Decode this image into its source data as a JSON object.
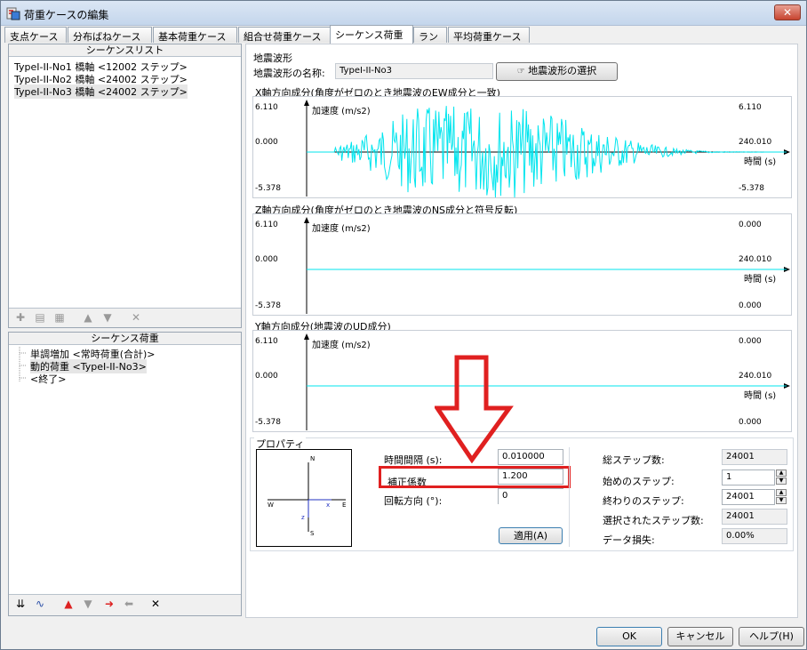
{
  "window": {
    "title": "荷重ケースの編集",
    "close_label": "✕"
  },
  "tabs": [
    "支点ケース",
    "分布ばねケース",
    "基本荷重ケース",
    "組合せ荷重ケース",
    "シーケンス荷重",
    "ラン",
    "平均荷重ケース"
  ],
  "sequence_list": {
    "header": "シーケンスリスト",
    "items": [
      "TypeI-II-No1 橋軸 <12002 ステップ>",
      "TypeI-II-No2 橋軸 <24002 ステップ>",
      "TypeI-II-No3 橋軸 <24002 ステップ>"
    ]
  },
  "sequence_load": {
    "header": "シーケンス荷重",
    "items": [
      "単調増加 <常時荷重(合計)>",
      "動的荷重 <TypeI-II-No3>",
      "<終了>"
    ]
  },
  "earthquake": {
    "group_label": "地震波形",
    "name_label": "地震波形の名称:",
    "name_value": "TypeI-II-No3",
    "select_button": "地震波形の選択"
  },
  "charts": [
    {
      "label": "X軸方向成分(角度がゼロのとき地震波のEW成分と一致)",
      "ymax": "6.110",
      "ymid": "0.000",
      "ymin": "-5.378",
      "ytitle": "加速度 (m/s2)",
      "rtop": "6.110",
      "rmid": "240.010",
      "rbot": "-5.378",
      "xtitle": "時間 (s)"
    },
    {
      "label": "Z軸方向成分(角度がゼロのとき地震波のNS成分と符号反転)",
      "ymax": "6.110",
      "ymid": "0.000",
      "ymin": "-5.378",
      "ytitle": "加速度 (m/s2)",
      "rtop": "0.000",
      "rmid": "240.010",
      "rbot": "0.000",
      "xtitle": "時間 (s)"
    },
    {
      "label": "Y軸方向成分(地震波のUD成分)",
      "ymax": "6.110",
      "ymid": "0.000",
      "ymin": "-5.378",
      "ytitle": "加速度 (m/s2)",
      "rtop": "0.000",
      "rmid": "240.010",
      "rbot": "0.000",
      "xtitle": "時間 (s)"
    }
  ],
  "properties": {
    "group_label": "プロパティ",
    "compass": {
      "n": "N",
      "s": "S",
      "w": "W",
      "e": "E",
      "x": "x",
      "z": "z"
    },
    "time_interval_label": "時間間隔 (s):",
    "time_interval_value": "0.010000",
    "correction_label": "補正係数",
    "correction_value": "1.200",
    "rotation_label": "回転方向 (°):",
    "rotation_value": "0",
    "apply_button": "適用(A)",
    "total_steps_label": "総ステップ数:",
    "total_steps_value": "24001",
    "start_step_label": "始めのステップ:",
    "start_step_value": "1",
    "end_step_label": "終わりのステップ:",
    "end_step_value": "24001",
    "selected_steps_label": "選択されたステップ数:",
    "selected_steps_value": "24001",
    "data_loss_label": "データ損失:",
    "data_loss_value": "0.00%"
  },
  "footer": {
    "ok": "OK",
    "cancel": "キャンセル",
    "help": "ヘルプ(H)"
  },
  "colors": {
    "waveform": "#00e5ee",
    "annotation": "#e02020"
  }
}
